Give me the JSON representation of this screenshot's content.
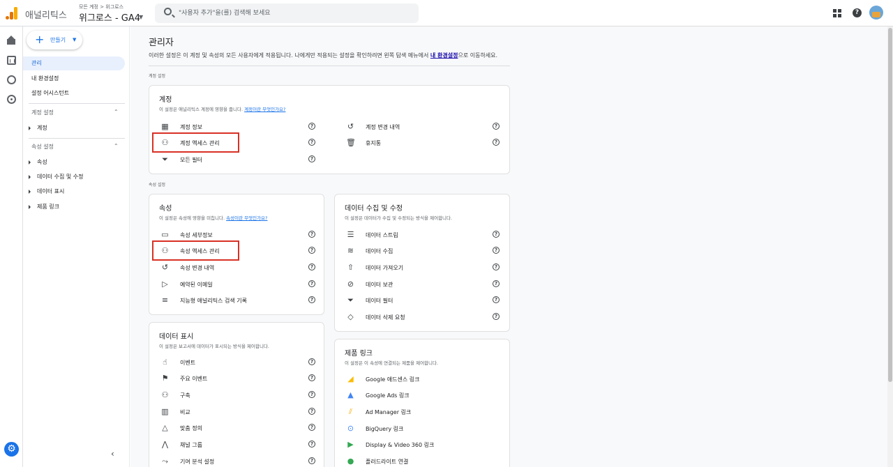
{
  "header": {
    "app_name": "애널리틱스",
    "breadcrumb": "모든 계정 > 위그로스",
    "property": "위그로스 - GA4",
    "search_placeholder": "\"사용자 추가\"을(를) 검색해 보세요"
  },
  "sidebar": {
    "create_label": "만들기",
    "items": [
      "관리",
      "내 환경설정",
      "설정 어시스턴트"
    ],
    "account_section": "계정 설정",
    "account_sub": [
      "계정"
    ],
    "property_section": "속성 설정",
    "property_sub": [
      "속성",
      "데이터 수집 및 수정",
      "데이터 표시",
      "제품 링크"
    ]
  },
  "page": {
    "title": "관리자",
    "desc_pre": "이러한 설정은 이 계정 및 속성의 모든 사용자에게 적용됩니다. 나에게만 적용되는 설정을 확인하려면 왼쪽 탐색 메뉴에서",
    "desc_link": "내 환경설정",
    "desc_post": "으로 이동하세요.",
    "account_group": "계정 설정",
    "property_group": "속성 설정"
  },
  "cards": {
    "account": {
      "title": "계정",
      "desc": "이 설정은 애널리틱스 계정에 영향을 줍니다.",
      "desc_link": "계정이란 무엇인가요?",
      "left": [
        {
          "icon": "building-icon",
          "label": "계정 정보"
        },
        {
          "icon": "people-icon",
          "label": "계정 액세스 관리"
        },
        {
          "icon": "filter-icon",
          "label": "모든 필터"
        }
      ],
      "right": [
        {
          "icon": "history-icon",
          "label": "계정 변경 내역"
        },
        {
          "icon": "trash-icon",
          "label": "휴지통"
        }
      ]
    },
    "property": {
      "title": "속성",
      "desc": "이 설정은 속성에 영향을 미칩니다.",
      "desc_link": "속성이란 무엇인가요?",
      "rows": [
        {
          "icon": "details-icon",
          "label": "속성 세부정보"
        },
        {
          "icon": "people-icon",
          "label": "속성 액세스 관리"
        },
        {
          "icon": "history-icon",
          "label": "속성 변경 내역"
        },
        {
          "icon": "scheduled-email-icon",
          "label": "예약된 이메일"
        },
        {
          "icon": "search-history-icon",
          "label": "지능형 애널리틱스 검색 기록"
        }
      ]
    },
    "data_collection": {
      "title": "데이터 수집 및 수정",
      "desc": "이 설정은 데이터가 수집 및 수정되는 방식을 제어합니다.",
      "rows": [
        {
          "icon": "stream-icon",
          "label": "데이터 스트림"
        },
        {
          "icon": "database-icon",
          "label": "데이터 수집"
        },
        {
          "icon": "upload-icon",
          "label": "데이터 가져오기"
        },
        {
          "icon": "retention-icon",
          "label": "데이터 보관"
        },
        {
          "icon": "filter-icon",
          "label": "데이터 필터"
        },
        {
          "icon": "eraser-icon",
          "label": "데이터 삭제 요청"
        }
      ]
    },
    "data_display": {
      "title": "데이터 표시",
      "desc": "이 설정은 보고서에 데이터가 표시되는 방식을 제어합니다.",
      "rows": [
        {
          "icon": "touch-icon",
          "label": "이벤트"
        },
        {
          "icon": "flag-icon",
          "label": "주요 이벤트"
        },
        {
          "icon": "audience-icon",
          "label": "구축"
        },
        {
          "icon": "compare-icon",
          "label": "비교"
        },
        {
          "icon": "shapes-icon",
          "label": "맞춤 정의"
        },
        {
          "icon": "channel-icon",
          "label": "채널 그룹"
        },
        {
          "icon": "attribution-icon",
          "label": "기여 분석 설정"
        }
      ]
    },
    "product_links": {
      "title": "제품 링크",
      "desc": "이 설정은 이 속성에 연결되는 제품을 제어합니다.",
      "rows": [
        {
          "icon": "adsense-icon",
          "label": "Google 애드센스 링크"
        },
        {
          "icon": "google-ads-icon",
          "label": "Google Ads 링크"
        },
        {
          "icon": "ad-manager-icon",
          "label": "Ad Manager 링크"
        },
        {
          "icon": "bigquery-icon",
          "label": "BigQuery 링크"
        },
        {
          "icon": "dv360-icon",
          "label": "Display & Video 360 링크"
        },
        {
          "icon": "floodlight-icon",
          "label": "플러드라이트 연결"
        }
      ]
    }
  },
  "colors": {
    "accent": "#1a73e8",
    "highlight": "#d93025"
  }
}
